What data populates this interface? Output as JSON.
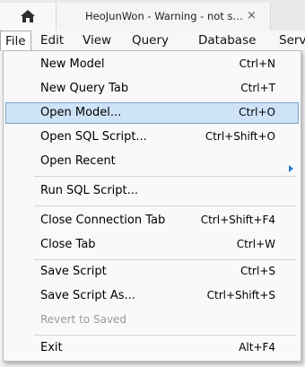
{
  "tab": {
    "title": "HeoJunWon - Warning - not s…",
    "close": "×",
    "home_icon": "home-icon"
  },
  "menubar": {
    "items": [
      "File",
      "Edit",
      "View",
      "Query",
      "Database",
      "Serv"
    ]
  },
  "file_menu": {
    "items": [
      {
        "label": "New Model",
        "shortcut": "Ctrl+N"
      },
      {
        "label": "New Query Tab",
        "shortcut": "Ctrl+T"
      },
      {
        "label": "Open Model...",
        "shortcut": "Ctrl+O"
      },
      {
        "label": "Open SQL Script...",
        "shortcut": "Ctrl+Shift+O"
      },
      {
        "label": "Open Recent",
        "shortcut": ""
      },
      {
        "label": "Run SQL Script...",
        "shortcut": ""
      },
      {
        "label": "Close Connection Tab",
        "shortcut": "Ctrl+Shift+F4"
      },
      {
        "label": "Close Tab",
        "shortcut": "Ctrl+W"
      },
      {
        "label": "Save Script",
        "shortcut": "Ctrl+S"
      },
      {
        "label": "Save Script As...",
        "shortcut": "Ctrl+Shift+S"
      },
      {
        "label": "Revert to Saved",
        "shortcut": ""
      },
      {
        "label": "Exit",
        "shortcut": "Alt+F4"
      }
    ]
  },
  "colors": {
    "highlight_bg": "#cfe3f8",
    "highlight_border": "#7da2ce",
    "submenu_arrow": "#2a7ad0"
  }
}
